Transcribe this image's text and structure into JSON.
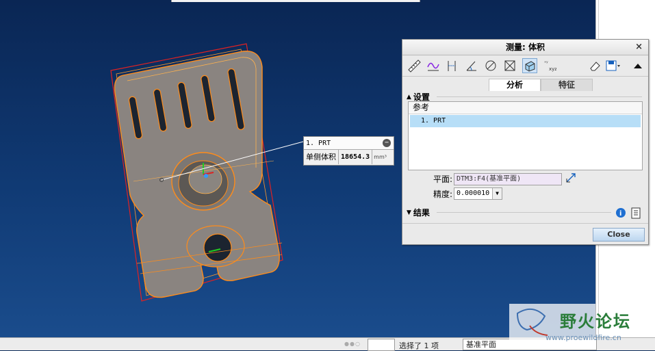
{
  "dialog": {
    "title": "测量: 体积",
    "close_symbol": "×",
    "tabs": [
      "分析",
      "特征"
    ],
    "settings_label": "设置",
    "references_header": "参考",
    "references_items": [
      "1. PRT"
    ],
    "plane_label": "平面:",
    "plane_value": "DTM3:F4(基准平面)",
    "accuracy_label": "精度:",
    "accuracy_value": "0.000010",
    "results_label": "结果",
    "close_button": "Close"
  },
  "callout": {
    "part": "1. PRT",
    "measure_label": "单侧体积",
    "measure_value": "18654.3",
    "unit": "mm³"
  },
  "statusbar": {
    "selection_text": "选择了 1 项",
    "filter_value": "基准平面"
  },
  "watermark": {
    "text": "野火论坛",
    "url": "www.proewildfire.cn"
  },
  "colors": {
    "viewport_top": "#0a2654",
    "viewport_bottom": "#1a4c8c",
    "model_edge": "#ff8c1a",
    "selected_row": "#b7def7"
  }
}
